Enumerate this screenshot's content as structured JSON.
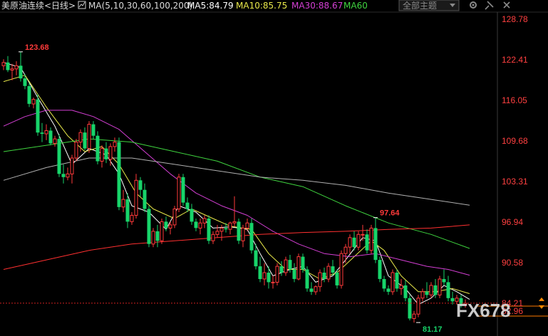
{
  "header": {
    "instrument": "美原油连续",
    "period": "<日线>",
    "ma_params": "MA(5,10,30,60,100,200)",
    "ma_values": [
      {
        "label": "MA5:84.79",
        "color": "#ffffff"
      },
      {
        "label": "MA10:85.75",
        "color": "#e8e84a"
      },
      {
        "label": "MA30:88.67",
        "color": "#d43fd4"
      },
      {
        "label": "MA60",
        "color": "#3fd43f"
      }
    ]
  },
  "controls": {
    "theme_select": "全部主题",
    "icon_names": [
      "indicator-settings-icon",
      "dropdown-arrow-icon",
      "settings-gear-icon",
      "pin-icon",
      "close-icon"
    ]
  },
  "watermark": "FX678",
  "colors": {
    "up": "#ff3a3a",
    "down": "#17d46a",
    "price_axis_text": "#ff4040",
    "ma5": "#ffffff",
    "ma10": "#e8e84a",
    "ma30": "#d43fd4",
    "ma60": "#3fd43f",
    "ma100": "#b0b0b0",
    "ma200": "#ff3030",
    "last_price_line": "#ff7a00"
  },
  "chart_data": {
    "type": "candlestick",
    "y_ticks": [
      "128.78",
      "122.41",
      "116.05",
      "109.68",
      "103.31",
      "96.94",
      "90.58",
      "84.21"
    ],
    "ylim": [
      79.5,
      129.8
    ],
    "last_price": "84.21",
    "lower_label": "82.96",
    "annotations": [
      {
        "text": "123.68",
        "value": 123.68,
        "index": 4
      },
      {
        "text": "97.64",
        "value": 97.64,
        "index": 87
      },
      {
        "text": "81.17",
        "value": 81.17,
        "index": 97
      }
    ],
    "candles": [
      [
        121.5,
        122.5,
        120.8,
        122.0
      ],
      [
        122.0,
        123.0,
        120.5,
        120.8
      ],
      [
        120.8,
        121.8,
        119.2,
        121.0
      ],
      [
        121.0,
        122.2,
        120.0,
        121.5
      ],
      [
        121.5,
        123.68,
        119.0,
        119.5
      ],
      [
        119.5,
        120.2,
        117.8,
        118.3
      ],
      [
        118.3,
        118.8,
        115.0,
        115.5
      ],
      [
        115.5,
        116.5,
        114.8,
        116.2
      ],
      [
        116.2,
        117.0,
        110.5,
        111.0
      ],
      [
        111.0,
        112.5,
        109.5,
        110.8
      ],
      [
        110.8,
        112.3,
        109.8,
        111.3
      ],
      [
        111.3,
        111.8,
        109.0,
        109.3
      ],
      [
        109.3,
        110.5,
        108.8,
        110.0
      ],
      [
        110.0,
        110.8,
        104.0,
        104.5
      ],
      [
        104.5,
        106.0,
        103.0,
        104.0
      ],
      [
        104.0,
        105.5,
        103.5,
        104.5
      ],
      [
        104.5,
        107.5,
        103.0,
        107.0
      ],
      [
        107.0,
        110.0,
        106.5,
        109.5
      ],
      [
        109.5,
        111.5,
        108.0,
        111.0
      ],
      [
        111.0,
        111.8,
        108.2,
        108.5
      ],
      [
        108.5,
        112.8,
        107.8,
        112.3
      ],
      [
        112.3,
        112.8,
        110.0,
        110.5
      ],
      [
        110.5,
        111.2,
        106.0,
        106.5
      ],
      [
        106.5,
        109.0,
        105.5,
        108.5
      ],
      [
        108.5,
        109.5,
        106.2,
        106.8
      ],
      [
        106.8,
        109.3,
        105.8,
        108.8
      ],
      [
        108.8,
        110.2,
        108.0,
        109.5
      ],
      [
        109.5,
        110.2,
        98.8,
        99.3
      ],
      [
        99.3,
        102.0,
        98.5,
        100.5
      ],
      [
        100.5,
        101.5,
        96.0,
        97.0
      ],
      [
        97.0,
        98.5,
        96.5,
        98.0
      ],
      [
        98.0,
        104.5,
        97.5,
        103.5
      ],
      [
        103.5,
        104.0,
        101.0,
        102.0
      ],
      [
        102.0,
        103.0,
        98.5,
        99.0
      ],
      [
        99.0,
        99.5,
        93.0,
        93.5
      ],
      [
        93.5,
        96.0,
        93.0,
        95.5
      ],
      [
        95.5,
        96.5,
        93.0,
        94.0
      ],
      [
        94.0,
        97.5,
        93.5,
        97.0
      ],
      [
        97.0,
        97.8,
        95.5,
        96.0
      ],
      [
        96.0,
        97.0,
        95.0,
        96.5
      ],
      [
        96.5,
        99.5,
        96.0,
        99.0
      ],
      [
        99.0,
        104.5,
        98.5,
        104.0
      ],
      [
        104.0,
        104.5,
        99.5,
        100.0
      ],
      [
        100.0,
        100.8,
        98.5,
        99.0
      ],
      [
        99.0,
        99.8,
        96.5,
        97.0
      ],
      [
        97.0,
        97.5,
        95.5,
        96.0
      ],
      [
        96.0,
        97.5,
        95.0,
        96.8
      ],
      [
        96.8,
        98.0,
        96.0,
        97.5
      ],
      [
        97.5,
        98.0,
        93.5,
        94.0
      ],
      [
        94.0,
        95.5,
        93.5,
        95.0
      ],
      [
        95.0,
        96.5,
        94.5,
        95.5
      ],
      [
        95.5,
        96.5,
        94.0,
        96.0
      ],
      [
        96.0,
        96.8,
        95.3,
        95.8
      ],
      [
        95.8,
        97.0,
        95.0,
        96.8
      ],
      [
        96.8,
        101.0,
        96.2,
        97.0
      ],
      [
        97.0,
        97.5,
        93.5,
        94.0
      ],
      [
        94.0,
        96.5,
        93.0,
        96.0
      ],
      [
        96.0,
        97.5,
        95.5,
        96.8
      ],
      [
        96.8,
        97.5,
        92.0,
        92.5
      ],
      [
        92.5,
        93.5,
        89.5,
        90.0
      ],
      [
        90.0,
        91.5,
        87.5,
        88.0
      ],
      [
        88.0,
        90.5,
        87.0,
        89.0
      ],
      [
        89.0,
        90.0,
        86.5,
        87.5
      ],
      [
        87.5,
        88.5,
        86.5,
        87.5
      ],
      [
        87.5,
        90.5,
        87.0,
        90.0
      ],
      [
        90.0,
        90.8,
        88.5,
        89.0
      ],
      [
        89.0,
        91.5,
        88.5,
        91.0
      ],
      [
        91.0,
        91.8,
        89.0,
        89.5
      ],
      [
        89.5,
        90.5,
        87.5,
        88.0
      ],
      [
        88.0,
        92.0,
        87.8,
        91.5
      ],
      [
        91.5,
        92.0,
        89.0,
        89.5
      ],
      [
        89.5,
        90.0,
        86.0,
        86.5
      ],
      [
        86.5,
        87.5,
        85.5,
        86.0
      ],
      [
        86.0,
        87.0,
        85.5,
        86.8
      ],
      [
        86.8,
        89.5,
        86.0,
        89.0
      ],
      [
        89.0,
        89.8,
        87.5,
        88.0
      ],
      [
        88.0,
        90.5,
        87.5,
        90.0
      ],
      [
        90.0,
        91.0,
        88.5,
        89.0
      ],
      [
        89.0,
        89.5,
        86.5,
        87.0
      ],
      [
        87.0,
        92.5,
        86.5,
        92.0
      ],
      [
        92.0,
        93.5,
        90.5,
        93.0
      ],
      [
        93.0,
        95.0,
        92.0,
        94.5
      ],
      [
        94.5,
        95.5,
        92.5,
        93.0
      ],
      [
        93.0,
        95.5,
        92.5,
        95.0
      ],
      [
        95.0,
        96.5,
        94.0,
        95.0
      ],
      [
        95.0,
        95.8,
        92.0,
        92.5
      ],
      [
        92.5,
        96.5,
        92.0,
        96.0
      ],
      [
        96.0,
        97.64,
        90.5,
        91.0
      ],
      [
        91.0,
        91.5,
        87.5,
        88.0
      ],
      [
        88.0,
        88.5,
        86.0,
        86.5
      ],
      [
        86.5,
        87.0,
        85.5,
        86.0
      ],
      [
        86.0,
        89.5,
        85.5,
        89.0
      ],
      [
        89.0,
        89.5,
        86.0,
        86.5
      ],
      [
        86.5,
        88.0,
        85.5,
        87.0
      ],
      [
        87.0,
        87.8,
        84.5,
        85.0
      ],
      [
        85.0,
        85.5,
        81.5,
        81.8
      ],
      [
        81.8,
        83.0,
        81.17,
        82.5
      ],
      [
        82.5,
        85.5,
        82.0,
        85.0
      ],
      [
        85.0,
        86.5,
        84.5,
        86.0
      ],
      [
        86.0,
        87.5,
        85.0,
        85.5
      ],
      [
        85.5,
        87.5,
        85.0,
        87.0
      ],
      [
        87.0,
        88.0,
        85.0,
        85.5
      ],
      [
        85.5,
        88.5,
        85.0,
        88.0
      ],
      [
        88.0,
        89.5,
        87.0,
        87.5
      ],
      [
        87.5,
        88.5,
        84.5,
        85.0
      ],
      [
        85.0,
        86.0,
        84.0,
        84.5
      ],
      [
        84.5,
        85.5,
        84.0,
        85.0
      ],
      [
        85.0,
        85.5,
        83.5,
        84.0
      ],
      [
        84.0,
        84.8,
        83.5,
        84.2
      ]
    ],
    "ma_lines": [
      {
        "name": "MA5",
        "values": [
          [
            0,
            122.0
          ],
          [
            4,
            121.2
          ],
          [
            8,
            116.5
          ],
          [
            12,
            112.0
          ],
          [
            16,
            106.0
          ],
          [
            20,
            108.5
          ],
          [
            24,
            107.5
          ],
          [
            27,
            104.5
          ],
          [
            30,
            99.5
          ],
          [
            34,
            98.5
          ],
          [
            38,
            95.8
          ],
          [
            41,
            99.5
          ],
          [
            45,
            98.5
          ],
          [
            49,
            96.0
          ],
          [
            53,
            96.2
          ],
          [
            57,
            95.8
          ],
          [
            60,
            92.0
          ],
          [
            63,
            88.5
          ],
          [
            67,
            89.5
          ],
          [
            70,
            90.0
          ],
          [
            73,
            87.5
          ],
          [
            77,
            88.5
          ],
          [
            80,
            91.0
          ],
          [
            84,
            94.5
          ],
          [
            87,
            94.0
          ],
          [
            90,
            88.5
          ],
          [
            94,
            86.5
          ],
          [
            97,
            84.0
          ],
          [
            100,
            85.0
          ],
          [
            103,
            87.0
          ],
          [
            106,
            86.0
          ],
          [
            109,
            84.8
          ]
        ]
      },
      {
        "name": "MA10",
        "values": [
          [
            0,
            119.0
          ],
          [
            5,
            120.0
          ],
          [
            10,
            115.0
          ],
          [
            15,
            110.5
          ],
          [
            19,
            108.0
          ],
          [
            23,
            108.8
          ],
          [
            27,
            106.0
          ],
          [
            31,
            101.5
          ],
          [
            35,
            99.0
          ],
          [
            40,
            97.5
          ],
          [
            44,
            99.0
          ],
          [
            49,
            97.5
          ],
          [
            53,
            96.3
          ],
          [
            58,
            95.8
          ],
          [
            62,
            92.0
          ],
          [
            66,
            89.5
          ],
          [
            70,
            89.5
          ],
          [
            74,
            88.0
          ],
          [
            78,
            89.0
          ],
          [
            82,
            91.5
          ],
          [
            86,
            94.0
          ],
          [
            89,
            92.5
          ],
          [
            93,
            88.5
          ],
          [
            97,
            86.0
          ],
          [
            101,
            86.0
          ],
          [
            105,
            86.5
          ],
          [
            109,
            85.7
          ]
        ]
      },
      {
        "name": "MA30",
        "values": [
          [
            0,
            112.0
          ],
          [
            5,
            113.5
          ],
          [
            10,
            114.5
          ],
          [
            16,
            114.5
          ],
          [
            21,
            113.5
          ],
          [
            27,
            111.5
          ],
          [
            33,
            108.0
          ],
          [
            39,
            104.5
          ],
          [
            45,
            101.5
          ],
          [
            51,
            99.5
          ],
          [
            57,
            98.0
          ],
          [
            63,
            95.5
          ],
          [
            69,
            93.5
          ],
          [
            75,
            92.0
          ],
          [
            81,
            91.5
          ],
          [
            87,
            92.0
          ],
          [
            93,
            91.0
          ],
          [
            99,
            90.0
          ],
          [
            104,
            89.5
          ],
          [
            109,
            88.6
          ]
        ]
      },
      {
        "name": "MA60",
        "values": [
          [
            0,
            108.0
          ],
          [
            10,
            109.0
          ],
          [
            20,
            110.0
          ],
          [
            30,
            109.5
          ],
          [
            40,
            108.0
          ],
          [
            50,
            106.5
          ],
          [
            60,
            104.0
          ],
          [
            70,
            102.5
          ],
          [
            80,
            99.5
          ],
          [
            90,
            96.8
          ],
          [
            100,
            95.0
          ],
          [
            109,
            92.8
          ]
        ]
      },
      {
        "name": "MA100",
        "values": [
          [
            0,
            103.5
          ],
          [
            10,
            105.5
          ],
          [
            20,
            107.0
          ],
          [
            30,
            107.0
          ],
          [
            40,
            106.0
          ],
          [
            50,
            105.0
          ],
          [
            60,
            104.0
          ],
          [
            70,
            103.5
          ],
          [
            80,
            102.7
          ],
          [
            90,
            101.5
          ],
          [
            100,
            100.5
          ],
          [
            109,
            99.6
          ]
        ]
      },
      {
        "name": "MA200",
        "values": [
          [
            0,
            89.5
          ],
          [
            10,
            91.0
          ],
          [
            20,
            92.5
          ],
          [
            30,
            93.5
          ],
          [
            40,
            94.0
          ],
          [
            50,
            94.5
          ],
          [
            60,
            95.0
          ],
          [
            70,
            95.3
          ],
          [
            80,
            95.5
          ],
          [
            90,
            95.8
          ],
          [
            100,
            96.0
          ],
          [
            109,
            96.5
          ]
        ]
      }
    ]
  }
}
